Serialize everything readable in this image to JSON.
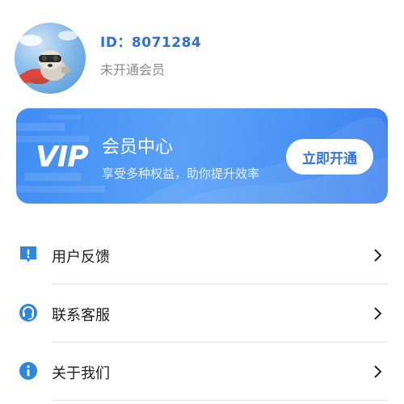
{
  "profile": {
    "id_text": "ID：8071284",
    "status": "未开通会员"
  },
  "vip_card": {
    "logo": "VIP",
    "title": "会员中心",
    "subtitle": "享受多种权益，助你提升效率",
    "button_label": "立即开通",
    "accent_color": "#3f8cf3"
  },
  "menu": {
    "items": [
      {
        "label": "用户反馈",
        "icon": "feedback-icon"
      },
      {
        "label": "联系客服",
        "icon": "customer-service-icon"
      },
      {
        "label": "关于我们",
        "icon": "info-icon"
      }
    ]
  },
  "colors": {
    "primary": "#2f6fd8",
    "icon_blue": "#2e86de",
    "divider": "#e3e3e3"
  }
}
